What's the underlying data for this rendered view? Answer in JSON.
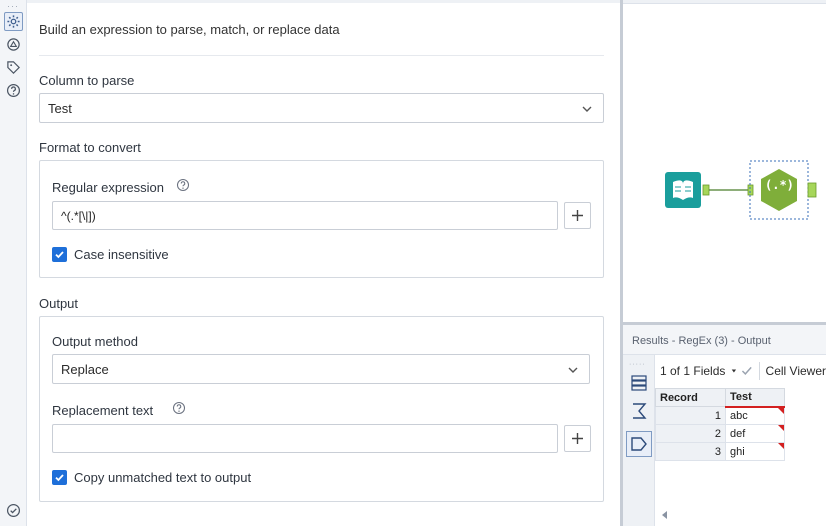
{
  "config": {
    "description": "Build an expression to parse, match, or replace data",
    "column_to_parse": {
      "label": "Column to parse",
      "value": "Test"
    },
    "format_to_convert": {
      "label": "Format to convert",
      "regex_label": "Regular expression",
      "regex_value": "^(.*[\\|])",
      "case_insensitive_label": "Case insensitive",
      "case_insensitive_checked": true
    },
    "output": {
      "label": "Output",
      "method_label": "Output method",
      "method_value": "Replace",
      "replacement_label": "Replacement text",
      "replacement_value": "",
      "copy_unmatched_label": "Copy unmatched text to output",
      "copy_unmatched_checked": true
    }
  },
  "canvas": {
    "regex_tool_label": "(.*)"
  },
  "results": {
    "title": "Results - RegEx (3) - Output",
    "fields_selector": "1 of 1 Fields",
    "cell_viewer": "Cell Viewer",
    "columns": [
      "Record",
      "Test"
    ],
    "rows": [
      {
        "record": "1",
        "test": "abc"
      },
      {
        "record": "2",
        "test": "def"
      },
      {
        "record": "3",
        "test": "ghi"
      }
    ]
  },
  "colors": {
    "accent": "#1e6fd9",
    "tool_green": "#7fae3a",
    "input_teal": "#1a9e9c",
    "marker_red": "#d32020"
  }
}
